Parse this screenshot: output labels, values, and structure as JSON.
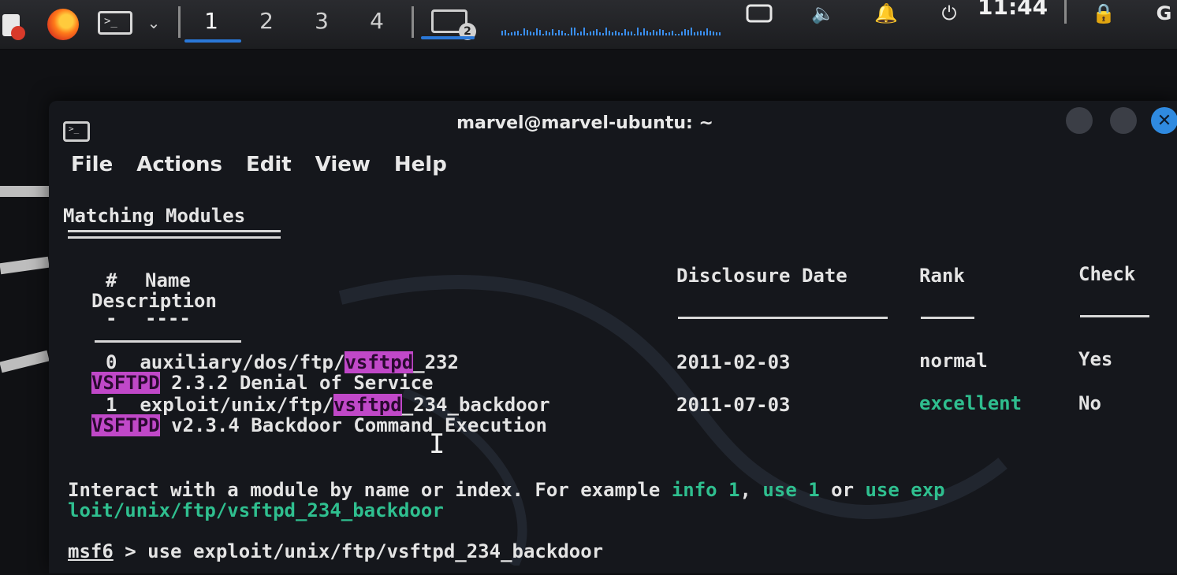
{
  "panel": {
    "workspaces": [
      "1",
      "2",
      "3",
      "4"
    ],
    "active_workspace": "1",
    "window_count_badge": "2",
    "clock": "11:44",
    "icons": [
      "app-menu-icon",
      "firefox-icon",
      "terminal-icon",
      "chevron-down-icon",
      "volume-icon",
      "notification-bell-icon",
      "power-icon",
      "lock-icon"
    ]
  },
  "window": {
    "title": "marvel@marvel-ubuntu: ~",
    "menu": [
      "File",
      "Actions",
      "Edit",
      "View",
      "Help"
    ]
  },
  "terminal": {
    "section_title": "Matching Modules",
    "headers": {
      "index": "#",
      "name": "Name",
      "date": "Disclosure Date",
      "rank": "Rank",
      "check": "Check",
      "description": "Description"
    },
    "header_rules": {
      "index": "-",
      "name": "----"
    },
    "rows": [
      {
        "index": "0",
        "path_prefix": "auxiliary/dos/ftp/",
        "path_highlight": "vsftpd",
        "path_suffix": "_232",
        "date": "2011-02-03",
        "rank": "normal",
        "check": "Yes",
        "desc_highlight": "VSFTPD",
        "desc_rest": " 2.3.2 Denial of Service"
      },
      {
        "index": "1",
        "path_prefix": "exploit/unix/ftp/",
        "path_highlight": "vsftpd",
        "path_suffix": "_234_backdoor",
        "date": "2011-07-03",
        "rank": "excellent",
        "check": "No",
        "desc_highlight": "VSFTPD",
        "desc_rest": " v2.3.4 Backdoor Command Execution"
      }
    ],
    "interact": {
      "text1": "Interact with a module by name or index. For example ",
      "cmd1": "info 1",
      "sep1": ", ",
      "cmd2": "use 1",
      "sep2": " or ",
      "cmd3_part1": "use exp",
      "cmd3_part2": "loit/unix/ftp/vsftpd_234_backdoor"
    },
    "prompt": "msf6",
    "prompt_cmd": " > use exploit/unix/ftp/vsftpd_234_backdoor"
  }
}
